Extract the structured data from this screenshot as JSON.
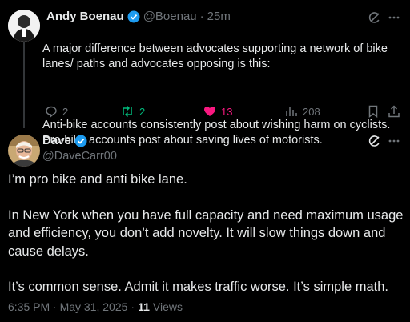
{
  "reply_to": {
    "author_name": "Andy Boenau",
    "handle": "@Boenau",
    "separator": "·",
    "time": "25m",
    "text_line1": "A major difference between advocates supporting a network of bike lanes/ paths and advocates opposing is this:",
    "text_line2": "Anti-bike accounts consistently post about wishing harm on cyclists. Pro-bike accounts post about saving lives of motorists.",
    "actions": {
      "replies": "2",
      "reposts": "2",
      "likes": "13",
      "views": "208"
    }
  },
  "tweet": {
    "author_name": "Dave",
    "handle": "@DaveCarr00",
    "paragraphs": [
      "I’m pro bike and anti bike lane.",
      "In New York when you have full capacity and need maximum usage and efficiency, you don’t add novelty. It will slow things down and cause delays.",
      "It’s common sense.  Admit it makes traffic worse. It’s simple math."
    ],
    "timestamp": "6:35 PM · May 31, 2025",
    "dot": "·",
    "view_count": "11",
    "views_label": "Views"
  },
  "colors": {
    "verified": "#1d9bf0",
    "repost": "#00ba7c",
    "like": "#f91880",
    "muted": "#71767b"
  }
}
